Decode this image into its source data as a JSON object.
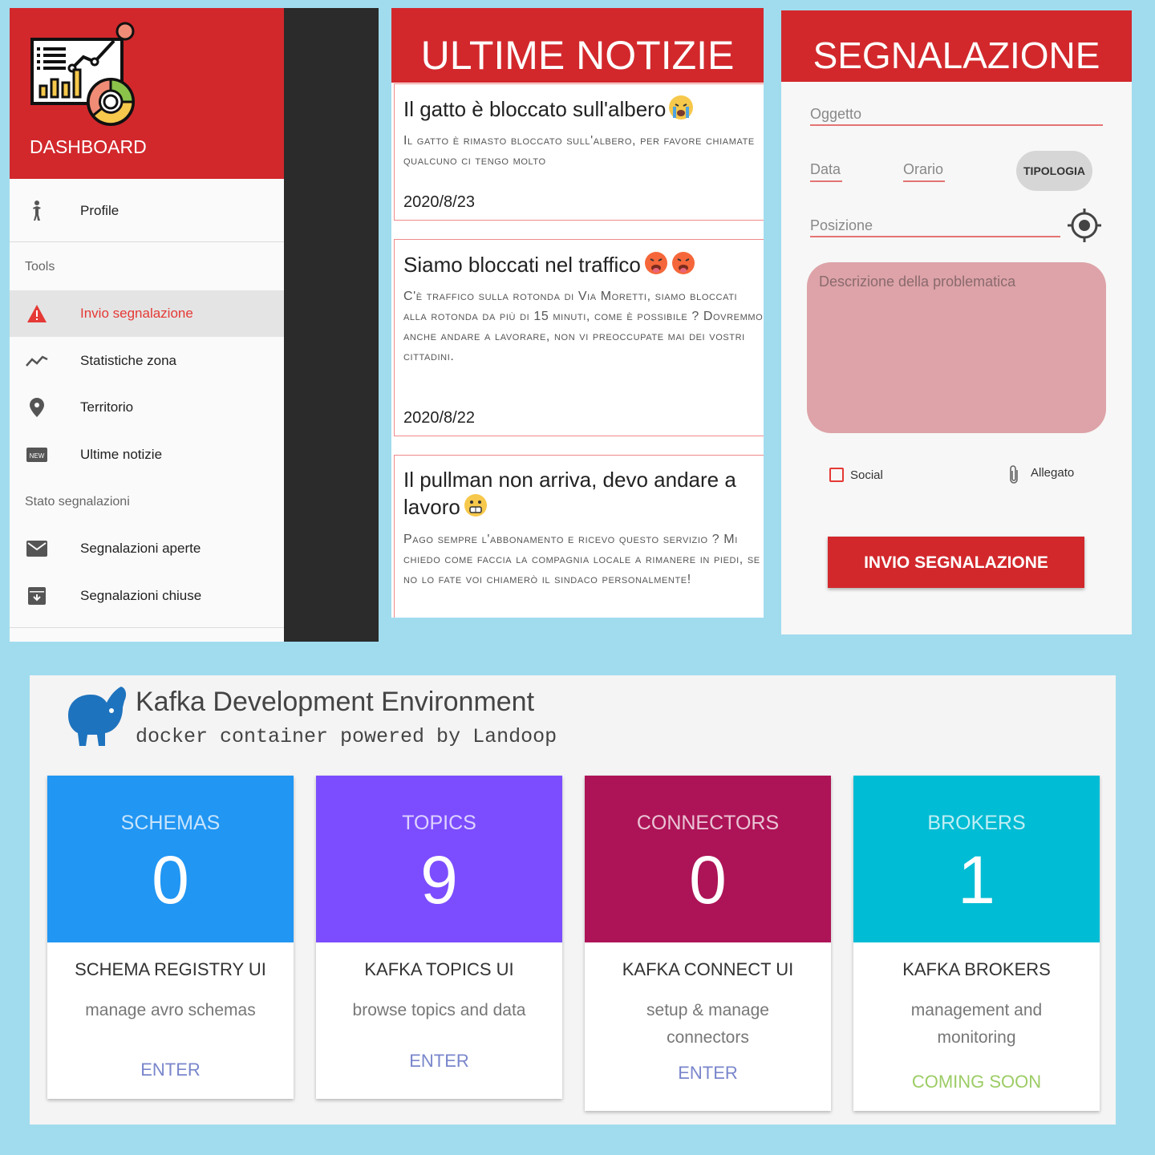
{
  "drawer": {
    "title": "DASHBOARD",
    "profile": "Profile",
    "section_tools": "Tools",
    "items": [
      {
        "label": "Invio segnalazione",
        "icon": "warning-icon"
      },
      {
        "label": "Statistiche zona",
        "icon": "trending-icon"
      },
      {
        "label": "Territorio",
        "icon": "location-pin-icon"
      },
      {
        "label": "Ultime notizie",
        "icon": "new-badge-icon"
      }
    ],
    "section_stato": "Stato segnalazioni",
    "stato_items": [
      {
        "label": "Segnalazioni aperte",
        "icon": "mail-icon"
      },
      {
        "label": "Segnalazioni chiuse",
        "icon": "archive-icon"
      }
    ],
    "active_color": "#e53935"
  },
  "news": {
    "header": "ULTIME NOTIZIE",
    "items": [
      {
        "title": "Il gatto è bloccato sull'albero",
        "body": "Il gatto è rimasto bloccato sull'albero, per favore chiamate qualcuno ci tengo molto",
        "date": "2020/8/23"
      },
      {
        "title": "Siamo bloccati nel traffico",
        "body": "C'è traffico sulla rotonda di Via Moretti, siamo bloccati alla rotonda da più di 15 minuti, come è possibile ? Dovremmo anche andare a lavorare, non vi preoccupate mai dei vostri cittadini.",
        "date": "2020/8/22"
      },
      {
        "title": "Il pullman non arriva, devo andare a lavoro",
        "body": "Pago sempre l'abbonamento e ricevo questo servizio ? Mi chiedo come faccia la compagnia locale a rimanere in piedi, se no lo fate voi chiamerò il sindaco personalmente!"
      }
    ]
  },
  "form": {
    "header": "SEGNALAZIONE",
    "oggetto": "Oggetto",
    "data": "Data",
    "orario": "Orario",
    "tipologia": "TIPOLOGIA",
    "posizione": "Posizione",
    "descrizione_placeholder": "Descrizione della problematica",
    "social": "Social",
    "allegato": "Allegato",
    "submit": "INVIO SEGNALAZIONE"
  },
  "kafka": {
    "title": "Kafka Development Environment",
    "subtitle": "docker container powered by Landoop",
    "cards": [
      {
        "label": "SCHEMAS",
        "count": "0",
        "name": "SCHEMA REGISTRY UI",
        "desc": "manage avro schemas",
        "action": "ENTER",
        "color": "#2196f3",
        "action_color": "#7986cb"
      },
      {
        "label": "TOPICS",
        "count": "9",
        "name": "KAFKA TOPICS UI",
        "desc": "browse topics and data",
        "action": "ENTER",
        "color": "#7c4dff",
        "action_color": "#7986cb"
      },
      {
        "label": "CONNECTORS",
        "count": "0",
        "name": "KAFKA CONNECT UI",
        "desc": "setup & manage connectors",
        "action": "ENTER",
        "color": "#ad1457",
        "action_color": "#7986cb"
      },
      {
        "label": "BROKERS",
        "count": "1",
        "name": "KAFKA BROKERS",
        "desc": "management and monitoring",
        "action": "COMING SOON",
        "color": "#00bcd4",
        "action_color": "#9ccc65"
      }
    ]
  }
}
